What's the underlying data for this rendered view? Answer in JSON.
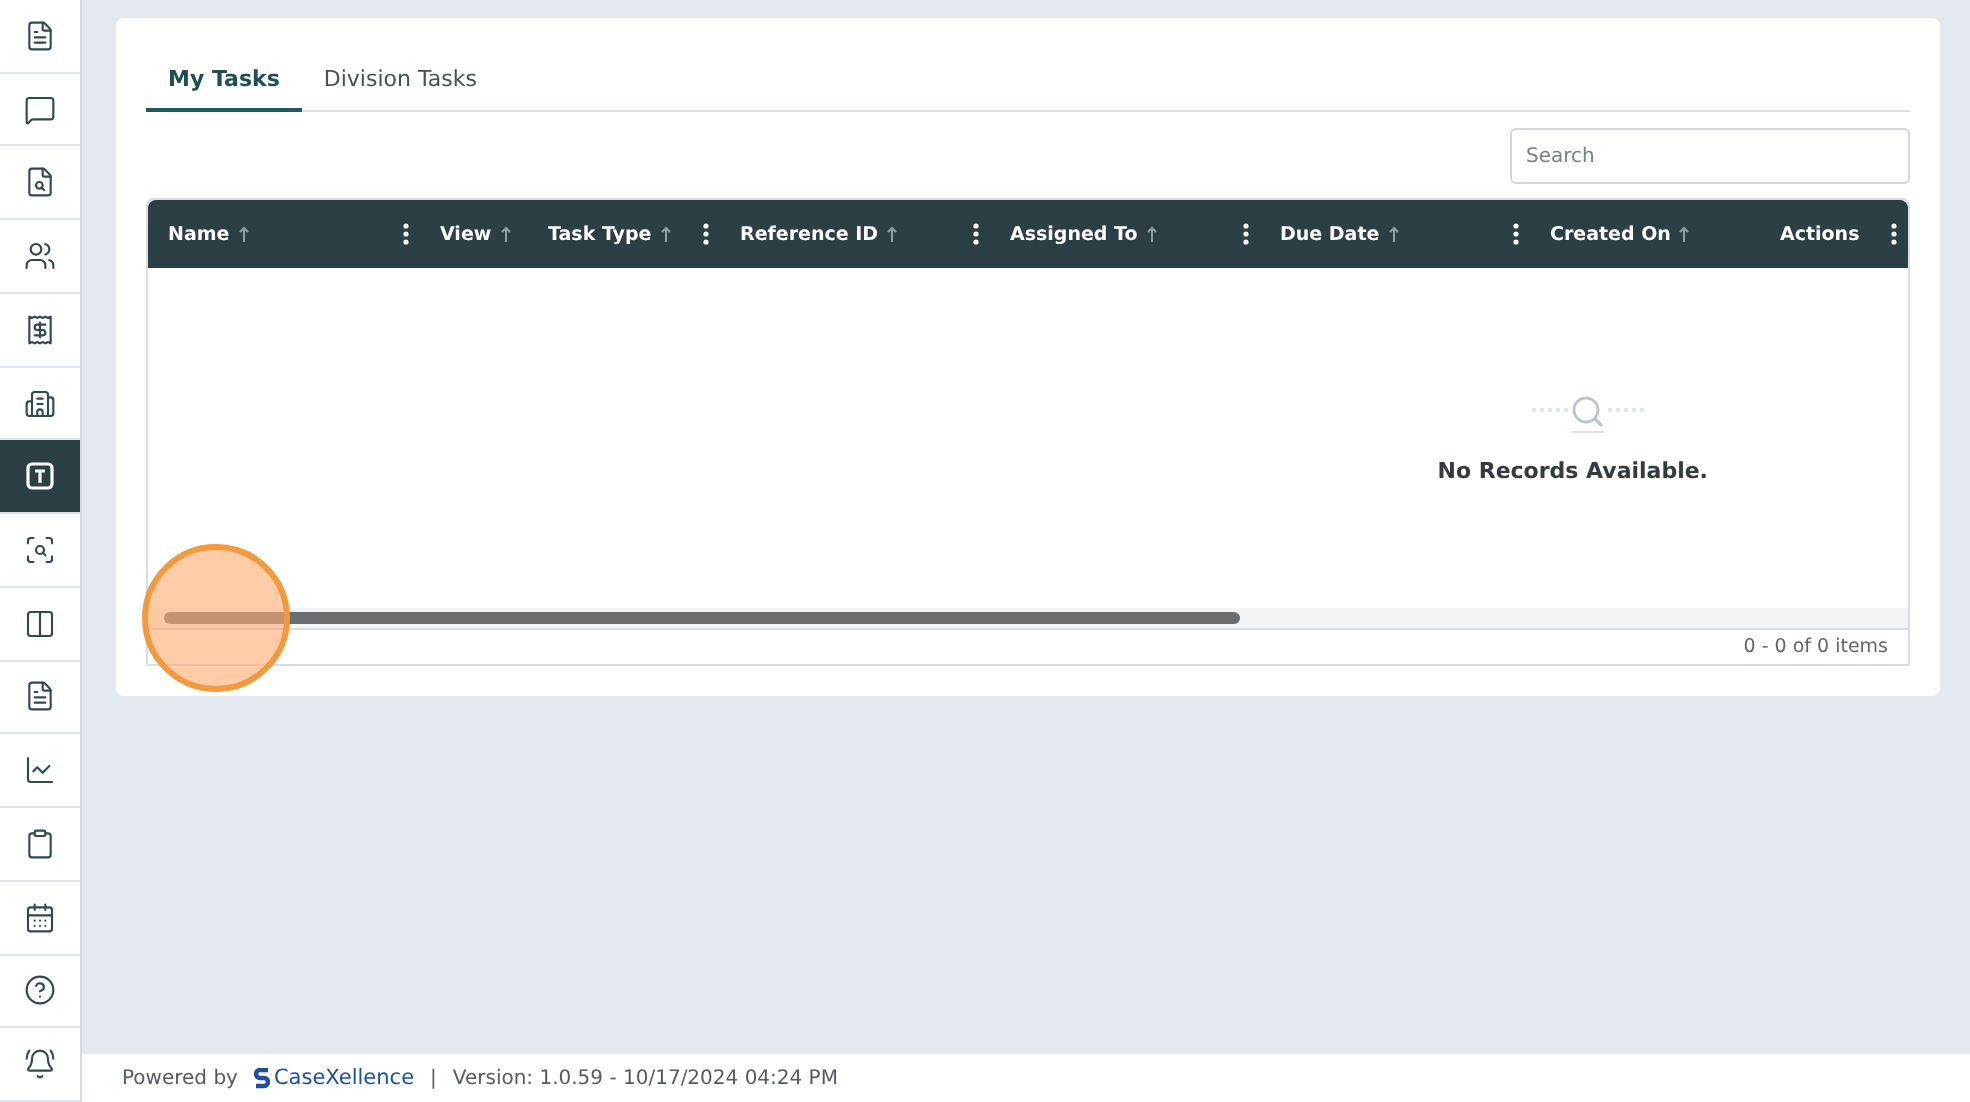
{
  "sidebar": {
    "items": [
      {
        "selected": false
      },
      {
        "selected": false
      },
      {
        "selected": false
      },
      {
        "selected": false
      },
      {
        "selected": false
      },
      {
        "selected": false
      },
      {
        "selected": true
      },
      {
        "selected": false
      },
      {
        "selected": false
      },
      {
        "selected": false
      },
      {
        "selected": false
      },
      {
        "selected": false
      },
      {
        "selected": false
      },
      {
        "selected": false
      },
      {
        "selected": false
      }
    ]
  },
  "tabs": [
    {
      "label": "My Tasks",
      "selected": true
    },
    {
      "label": "Division Tasks",
      "selected": false
    }
  ],
  "search": {
    "placeholder": "Search"
  },
  "table": {
    "columns": [
      {
        "label": "Name",
        "sortable": true,
        "menu": true
      },
      {
        "label": "View",
        "sortable": true,
        "menu": false
      },
      {
        "label": "Task Type",
        "sortable": true,
        "menu": true
      },
      {
        "label": "Reference ID",
        "sortable": true,
        "menu": true
      },
      {
        "label": "Assigned To",
        "sortable": true,
        "menu": true
      },
      {
        "label": "Due Date",
        "sortable": true,
        "menu": true
      },
      {
        "label": "Created On",
        "sortable": true,
        "menu": false
      },
      {
        "label": "Actions",
        "sortable": false,
        "menu": true
      }
    ],
    "empty_message": "No Records Available.",
    "pager": "0 - 0 of 0 items"
  },
  "footer": {
    "powered_by": "Powered by",
    "brand": "CaseXellence",
    "separator": "|",
    "version": "Version: 1.0.59 - 10/17/2024 04:24 PM"
  }
}
